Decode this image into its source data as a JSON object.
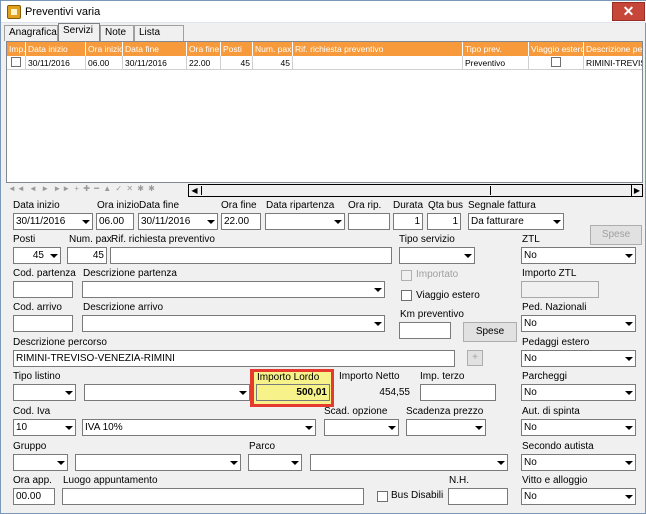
{
  "window": {
    "title": "Preventivi varia",
    "close_label": "✕"
  },
  "tabs": [
    "Anagrafica",
    "Servizi",
    "Note",
    "Lista"
  ],
  "grid": {
    "headers": [
      "Imp.",
      "Data inizio",
      "Ora inizio",
      "Data fine",
      "Ora fine",
      "Posti",
      "Num. pax",
      "Rif. richiesta preventivo",
      "Tipo prev.",
      "Viaggio estero",
      "Descrizione perco"
    ],
    "row": [
      "",
      "30/11/2016",
      "06.00",
      "30/11/2016",
      "22.00",
      "45",
      "45",
      "",
      "Preventivo",
      "",
      "RIMINI-TREVISO"
    ]
  },
  "navbar": {
    "buttons": "◄◄ ◄ ► ►► + ✚ ━ ▲ ✓ ✕ ✱ ✱"
  },
  "form": {
    "data_inizio": {
      "label": "Data inizio",
      "value": "30/11/2016"
    },
    "ora_inizio": {
      "label": "Ora inizio",
      "value": "06.00"
    },
    "data_fine": {
      "label": "Data fine",
      "value": "30/11/2016"
    },
    "ora_fine": {
      "label": "Ora fine",
      "value": "22.00"
    },
    "data_ripartenza": {
      "label": "Data ripartenza",
      "value": ""
    },
    "ora_rip": {
      "label": "Ora rip.",
      "value": ""
    },
    "durata": {
      "label": "Durata",
      "value": "1"
    },
    "qta_bus": {
      "label": "Qta bus",
      "value": "1"
    },
    "segnale_fattura": {
      "label": "Segnale fattura",
      "value": "Da fatturare"
    },
    "spese_varie": {
      "label": "Spese varie"
    },
    "posti": {
      "label": "Posti",
      "value": "45"
    },
    "num_pax": {
      "label": "Num. pax",
      "value": "45"
    },
    "rif_richiesta": {
      "label": "Rif. richiesta preventivo",
      "value": ""
    },
    "tipo_servizio": {
      "label": "Tipo servizio",
      "value": ""
    },
    "ztl": {
      "label": "ZTL",
      "value": "No"
    },
    "cod_partenza": {
      "label": "Cod. partenza",
      "value": ""
    },
    "descrizione_partenza": {
      "label": "Descrizione partenza",
      "value": ""
    },
    "importato": {
      "label": "Importato"
    },
    "importo_ztl": {
      "label": "Importo ZTL",
      "value": ""
    },
    "viaggio_estero": {
      "label": "Viaggio estero"
    },
    "cod_arrivo": {
      "label": "Cod. arrivo",
      "value": ""
    },
    "descrizione_arrivo": {
      "label": "Descrizione arrivo",
      "value": ""
    },
    "km_preventivo": {
      "label": "Km preventivo",
      "value": ""
    },
    "spese": {
      "label": "Spese"
    },
    "ped_nazionali": {
      "label": "Ped. Nazionali",
      "value": "No"
    },
    "descrizione_percorso": {
      "label": "Descrizione percorso",
      "value": "RIMINI-TREVISO-VENEZIA-RIMINI"
    },
    "plus": {
      "label": "+"
    },
    "pedaggi_estero": {
      "label": "Pedaggi estero",
      "value": "No"
    },
    "tipo_listino": {
      "label": "Tipo listino",
      "value": ""
    },
    "listino": {
      "value": ""
    },
    "importo_lordo": {
      "label": "Importo Lordo",
      "value": "500,01"
    },
    "importo_netto": {
      "label": "Importo Netto",
      "value": "454,55"
    },
    "imp_terzo": {
      "label": "Imp. terzo",
      "value": ""
    },
    "parcheggi": {
      "label": "Parcheggi",
      "value": "No"
    },
    "cod_iva": {
      "label": "Cod. Iva",
      "value": "10"
    },
    "iva_desc": {
      "value": "IVA 10%"
    },
    "scad_opzione": {
      "label": "Scad. opzione",
      "value": ""
    },
    "scadenza_prezzo": {
      "label": "Scadenza prezzo",
      "value": ""
    },
    "aut_spinta": {
      "label": "Aut. di spinta",
      "value": "No"
    },
    "gruppo": {
      "label": "Gruppo",
      "value": ""
    },
    "gruppo_desc": {
      "value": ""
    },
    "parco": {
      "label": "Parco",
      "value": ""
    },
    "parco_desc": {
      "value": ""
    },
    "secondo_autista": {
      "label": "Secondo autista",
      "value": "No"
    },
    "ora_app": {
      "label": "Ora app.",
      "value": "00.00"
    },
    "luogo_appuntamento": {
      "label": "Luogo appuntamento",
      "value": ""
    },
    "bus_disabili": {
      "label": "Bus Disabili"
    },
    "nh": {
      "label": "N.H.",
      "value": ""
    },
    "vitto_alloggio": {
      "label": "Vitto e alloggio",
      "value": "No"
    }
  }
}
